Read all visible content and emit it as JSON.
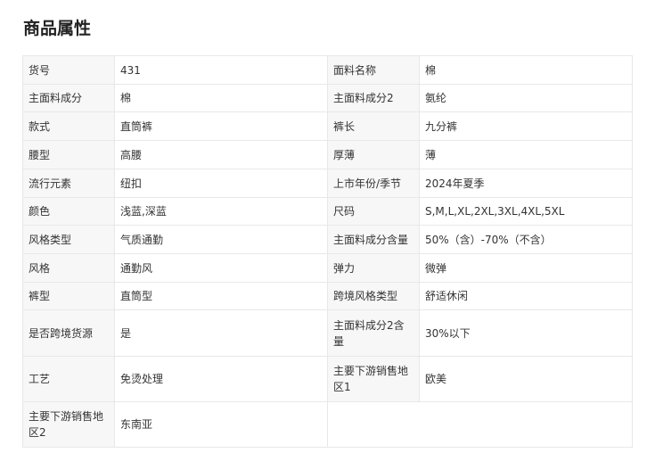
{
  "section": {
    "title": "商品属性"
  },
  "attributes": [
    {
      "left_key": "货号",
      "left_value": "431",
      "right_key": "面料名称",
      "right_value": "棉"
    },
    {
      "left_key": "主面料成分",
      "left_value": "棉",
      "right_key": "主面料成分2",
      "right_value": "氨纶"
    },
    {
      "left_key": "款式",
      "left_value": "直筒裤",
      "right_key": "裤长",
      "right_value": "九分裤"
    },
    {
      "left_key": "腰型",
      "left_value": "高腰",
      "right_key": "厚薄",
      "right_value": "薄"
    },
    {
      "left_key": "流行元素",
      "left_value": "纽扣",
      "right_key": "上市年份/季节",
      "right_value": "2024年夏季"
    },
    {
      "left_key": "颜色",
      "left_value": "浅蓝,深蓝",
      "right_key": "尺码",
      "right_value": "S,M,L,XL,2XL,3XL,4XL,5XL"
    },
    {
      "left_key": "风格类型",
      "left_value": "气质通勤",
      "right_key": "主面料成分含量",
      "right_value": "50%（含）-70%（不含）"
    },
    {
      "left_key": "风格",
      "left_value": "通勤风",
      "right_key": "弹力",
      "right_value": "微弹"
    },
    {
      "left_key": "裤型",
      "left_value": "直筒型",
      "right_key": "跨境风格类型",
      "right_value": "舒适休闲"
    },
    {
      "left_key": "是否跨境货源",
      "left_value": "是",
      "right_key": "主面料成分2含量",
      "right_value": "30%以下"
    },
    {
      "left_key": "工艺",
      "left_value": "免烫处理",
      "right_key": "主要下游销售地区1",
      "right_value": "欧美"
    },
    {
      "left_key": "主要下游销售地区2",
      "left_value": "东南亚",
      "right_key": "",
      "right_value": ""
    }
  ]
}
